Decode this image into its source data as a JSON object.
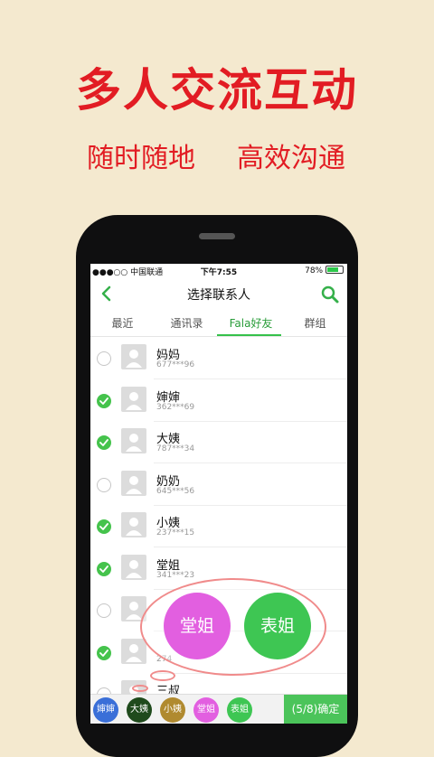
{
  "headline": "多人交流互动",
  "sub_left": "随时随地",
  "sub_right": "高效沟通",
  "status": {
    "carrier": "●●●○○ 中国联通",
    "time": "下午7:55",
    "battery": "78%",
    "battery_level": 0.78
  },
  "nav": {
    "title": "选择联系人"
  },
  "tabs": [
    {
      "label": "最近"
    },
    {
      "label": "通讯录"
    },
    {
      "label": "Fala好友"
    },
    {
      "label": "群组"
    }
  ],
  "contacts": [
    {
      "name": "妈妈",
      "phone": "677***96",
      "checked": false
    },
    {
      "name": "婶婶",
      "phone": "362***69",
      "checked": true
    },
    {
      "name": "大姨",
      "phone": "787***34",
      "checked": true
    },
    {
      "name": "奶奶",
      "phone": "645***56",
      "checked": false
    },
    {
      "name": "小姨",
      "phone": "237***15",
      "checked": true
    },
    {
      "name": "堂姐",
      "phone": "341***23",
      "checked": true
    },
    {
      "name": "",
      "phone": "",
      "checked": false
    },
    {
      "name": "",
      "phone": "274",
      "checked": true
    },
    {
      "name": "三叔",
      "phone": "",
      "checked": false
    }
  ],
  "bubbles": {
    "left": "堂姐",
    "right": "表姐"
  },
  "chips": [
    {
      "label": "婶婶",
      "color": "#3a6fd8"
    },
    {
      "label": "大姨",
      "color": "#1f4a1c"
    },
    {
      "label": "小姨",
      "color": "#b08a2f"
    },
    {
      "label": "堂姐",
      "color": "#e25fe0"
    },
    {
      "label": "表姐",
      "color": "#3ec653"
    }
  ],
  "confirm": "(5/8)确定",
  "colors": {
    "accent": "#e21c23",
    "green": "#45c34c",
    "background": "#f4e9cf"
  }
}
